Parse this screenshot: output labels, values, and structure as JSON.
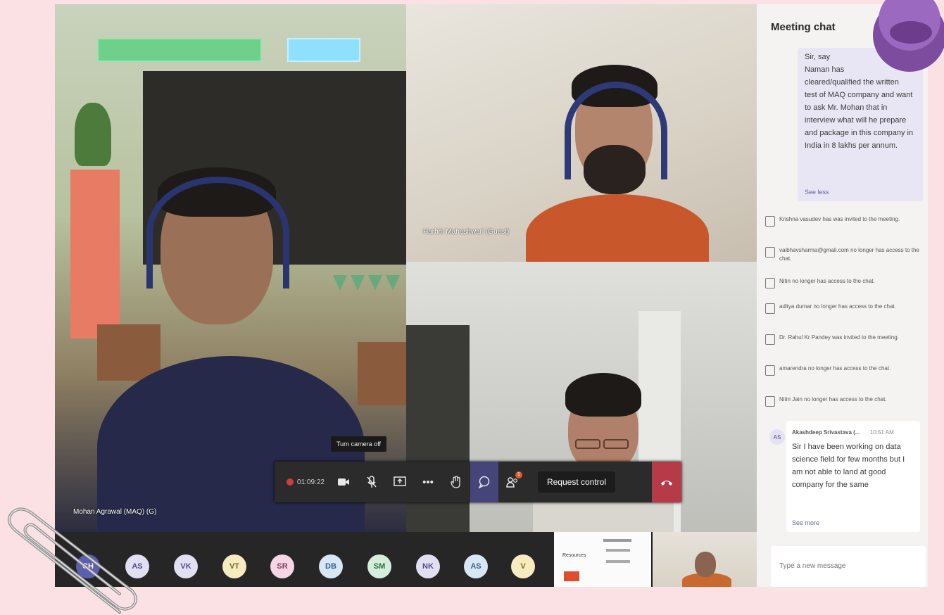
{
  "participants": {
    "main_name": "Mohan Agrawal (MAQ) (G)",
    "top_name": "Harbhi Maheshwari (Guest)",
    "strip_avatars": [
      {
        "initials": "CH",
        "bg": "#5a5fb0",
        "fg": "#ffffff"
      },
      {
        "initials": "AS",
        "bg": "#e3dff2",
        "fg": "#4b4c8f"
      },
      {
        "initials": "VK",
        "bg": "#e3dff2",
        "fg": "#4b4c8f"
      },
      {
        "initials": "VT",
        "bg": "#f7ecbf",
        "fg": "#7a6a23"
      },
      {
        "initials": "SR",
        "bg": "#f4d6e4",
        "fg": "#8a3a5e"
      },
      {
        "initials": "DB",
        "bg": "#d8e7f5",
        "fg": "#355f8a"
      },
      {
        "initials": "SM",
        "bg": "#d5eedc",
        "fg": "#2e6b40"
      },
      {
        "initials": "NK",
        "bg": "#e3dff2",
        "fg": "#4b4c8f"
      },
      {
        "initials": "AS",
        "bg": "#d8e7f5",
        "fg": "#355f8a"
      },
      {
        "initials": "V",
        "bg": "#f7ecbf",
        "fg": "#7a6a23"
      }
    ],
    "share_thumb_title": "Resources"
  },
  "callbar": {
    "timer": "01:09:22",
    "tooltip": "Turn camera off",
    "request_control": "Request control",
    "chat_badge": "1"
  },
  "chat": {
    "title": "Meeting chat",
    "bubble_lines": [
      "Sir, say",
      "Naman has",
      "cleared/qualified the written",
      "test of MAQ company and want",
      "to ask Mr. Mohan that in",
      "interview what will he prepare",
      "and package in this company in",
      "India in 8 lakhs per annum."
    ],
    "bubble_see_less": "See less",
    "system_messages": [
      "Krishna vasudev has was invited to the meeting.",
      "vaibhavsharma@gmail.com no longer has access to the chat.",
      "Nitin no longer has access to the chat.",
      "aditya dumar no longer has access to the chat.",
      "Dr. Rahul Kr Pandey was invited to the meeting.",
      "amarendra no longer has access to the chat.",
      "Nitin Jain no longer has access to the chat."
    ],
    "message": {
      "avatar": "AS",
      "author": "Akashdeep Srivastava (...",
      "time": "10:51 AM",
      "body": "Sir I have been working on data science field for few months but I am not able to land at good company for the same",
      "see_more": "See more"
    },
    "compose_placeholder": "Type a new message"
  },
  "colors": {
    "accent": "#6264a7",
    "hangup": "#b63a48",
    "page_bg": "#fbe1e4",
    "pushpin": "#7d4c9e"
  }
}
